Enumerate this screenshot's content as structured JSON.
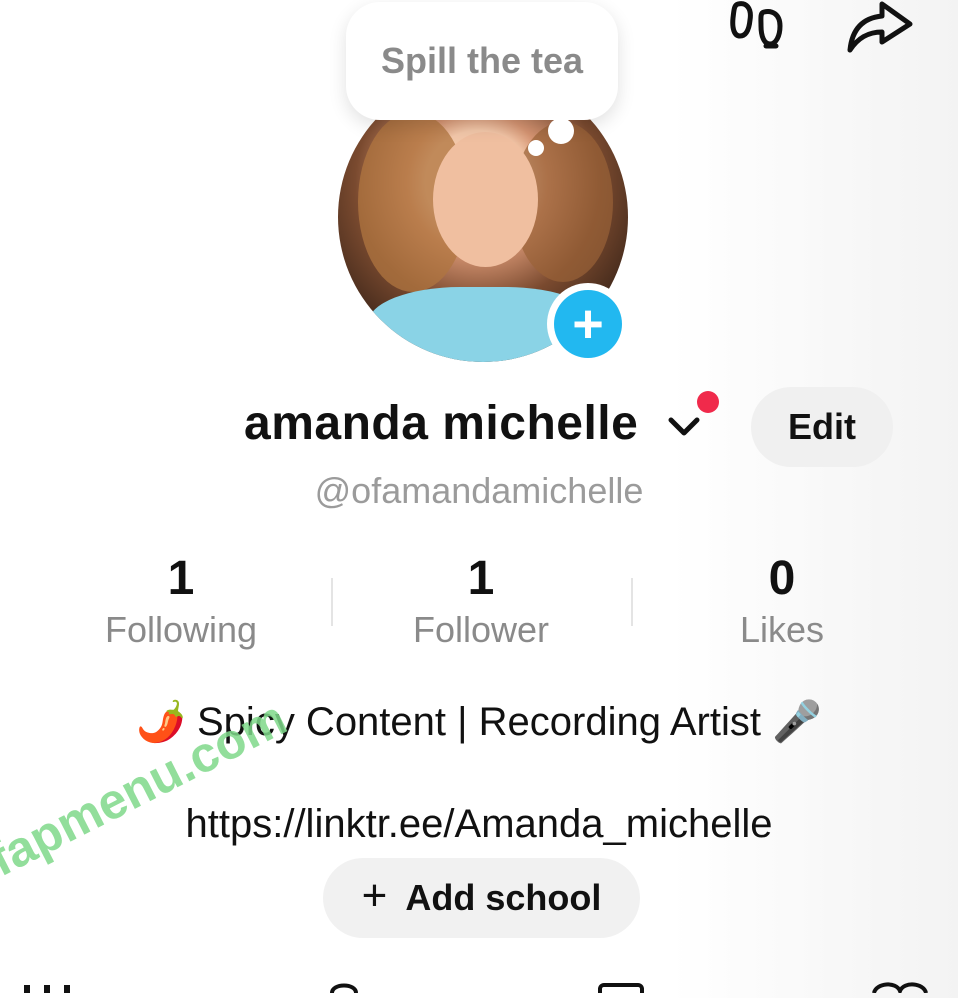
{
  "bubble": {
    "text": "Spill the tea"
  },
  "profile": {
    "display_name": "amanda michelle",
    "handle": "@ofamandamichelle",
    "edit_label": "Edit"
  },
  "stats": [
    {
      "value": "1",
      "label": "Following"
    },
    {
      "value": "1",
      "label": "Follower"
    },
    {
      "value": "0",
      "label": "Likes"
    }
  ],
  "bio": {
    "emoji_left": "🌶️",
    "text": "Spicy Content | Recording Artist",
    "emoji_right": "🎤",
    "link": "https://linktr.ee/Amanda_michelle"
  },
  "add_school": {
    "plus": "+",
    "label": "Add school"
  },
  "watermark": "fapmenu.com",
  "colors": {
    "accent_blue": "#22b8f0",
    "notification_red": "#f02a4b",
    "muted_text": "#8a8a8a"
  },
  "icons": [
    "footprints-icon",
    "share-icon",
    "add-plus-icon",
    "chevron-down-icon"
  ]
}
